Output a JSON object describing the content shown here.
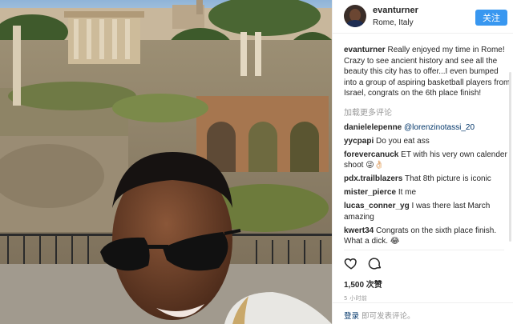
{
  "header": {
    "username": "evanturner",
    "location": "Rome, Italy",
    "follow_label": "关注"
  },
  "caption": {
    "username": "evanturner",
    "text": "Really enjoyed my time in Rome! Crazy to see ancient history and see all the beauty this city has to offer...I even bumped into a group of aspiring basketball players from Israel, congrats on the 6th place finish!"
  },
  "load_more_label": "加载更多评论",
  "comments": [
    {
      "username": "danielelepenne",
      "text": "",
      "mention": "@lorenzinotassi_20"
    },
    {
      "username": "yycpapi",
      "text": "Do you eat ass",
      "mention": ""
    },
    {
      "username": "forevercanuck",
      "text": "ET with his very own calender shoot 😜👌🏻",
      "mention": ""
    },
    {
      "username": "pdx.trailblazers",
      "text": "That 8th picture is iconic",
      "mention": ""
    },
    {
      "username": "mister_pierce",
      "text": "It me",
      "mention": ""
    },
    {
      "username": "lucas_conner_yg",
      "text": "I was there last March amazing",
      "mention": ""
    },
    {
      "username": "kwert34",
      "text": "Congrats on the sixth place finish. What a dick. 😂",
      "mention": ""
    }
  ],
  "likes_label": "1,500 次赞",
  "timestamp": "5 小时前",
  "login_bar": {
    "link": "登录",
    "text": "即可发表评论。"
  },
  "icons": [
    "like-heart-icon",
    "comment-bubble-icon"
  ],
  "colors": {
    "follow_button": "#3897f0",
    "mention": "#003569",
    "muted": "#999999"
  }
}
